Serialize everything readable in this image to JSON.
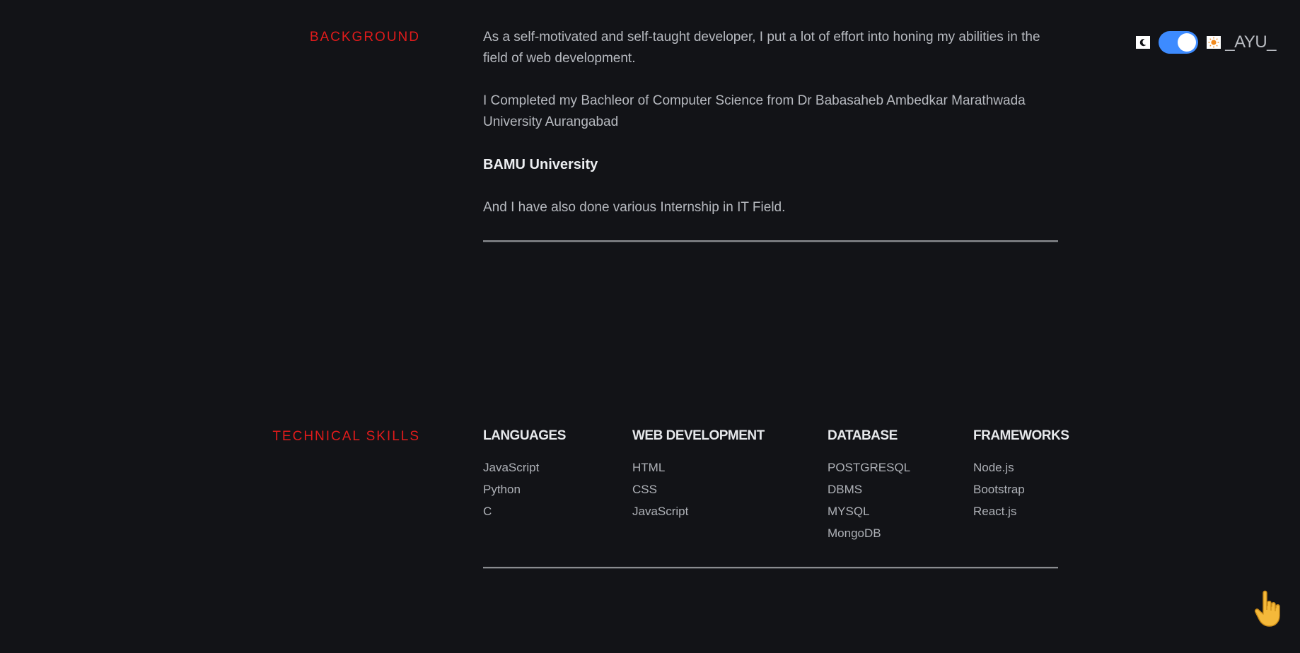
{
  "background": {
    "title": "BACKGROUND",
    "paragraphs": [
      "As a self-motivated and self-taught developer, I put a lot of effort into honing my abilities in the field of web development.",
      "I Completed my Bachleor of Computer Science from Dr Babasaheb Ambedkar Marathwada University Aurangabad"
    ],
    "university": "BAMU University",
    "internship": "And I have also done various Internship in IT Field."
  },
  "skills": {
    "title": "TECHNICAL SKILLS",
    "columns": [
      {
        "heading": "LANGUAGES",
        "items": [
          "JavaScript",
          "Python",
          "C"
        ]
      },
      {
        "heading": "WEB DEVELOPMENT",
        "items": [
          "HTML",
          "CSS",
          "JavaScript"
        ]
      },
      {
        "heading": "DATABASE",
        "items": [
          "POSTGRESQL",
          "DBMS",
          "MYSQL",
          "MongoDB"
        ]
      },
      {
        "heading": "FRAMEWORKS",
        "items": [
          "Node.js",
          "Bootstrap",
          "React.js"
        ]
      }
    ]
  },
  "header": {
    "brand": "_AYU_",
    "theme_toggle_on": true,
    "icons": {
      "left": "moon-icon",
      "right": "sun-icon",
      "cursor": "pointing-hand-icon"
    }
  },
  "colors": {
    "background": "#121317",
    "accent": "#e01b1b",
    "toggle": "#3d8bff"
  }
}
